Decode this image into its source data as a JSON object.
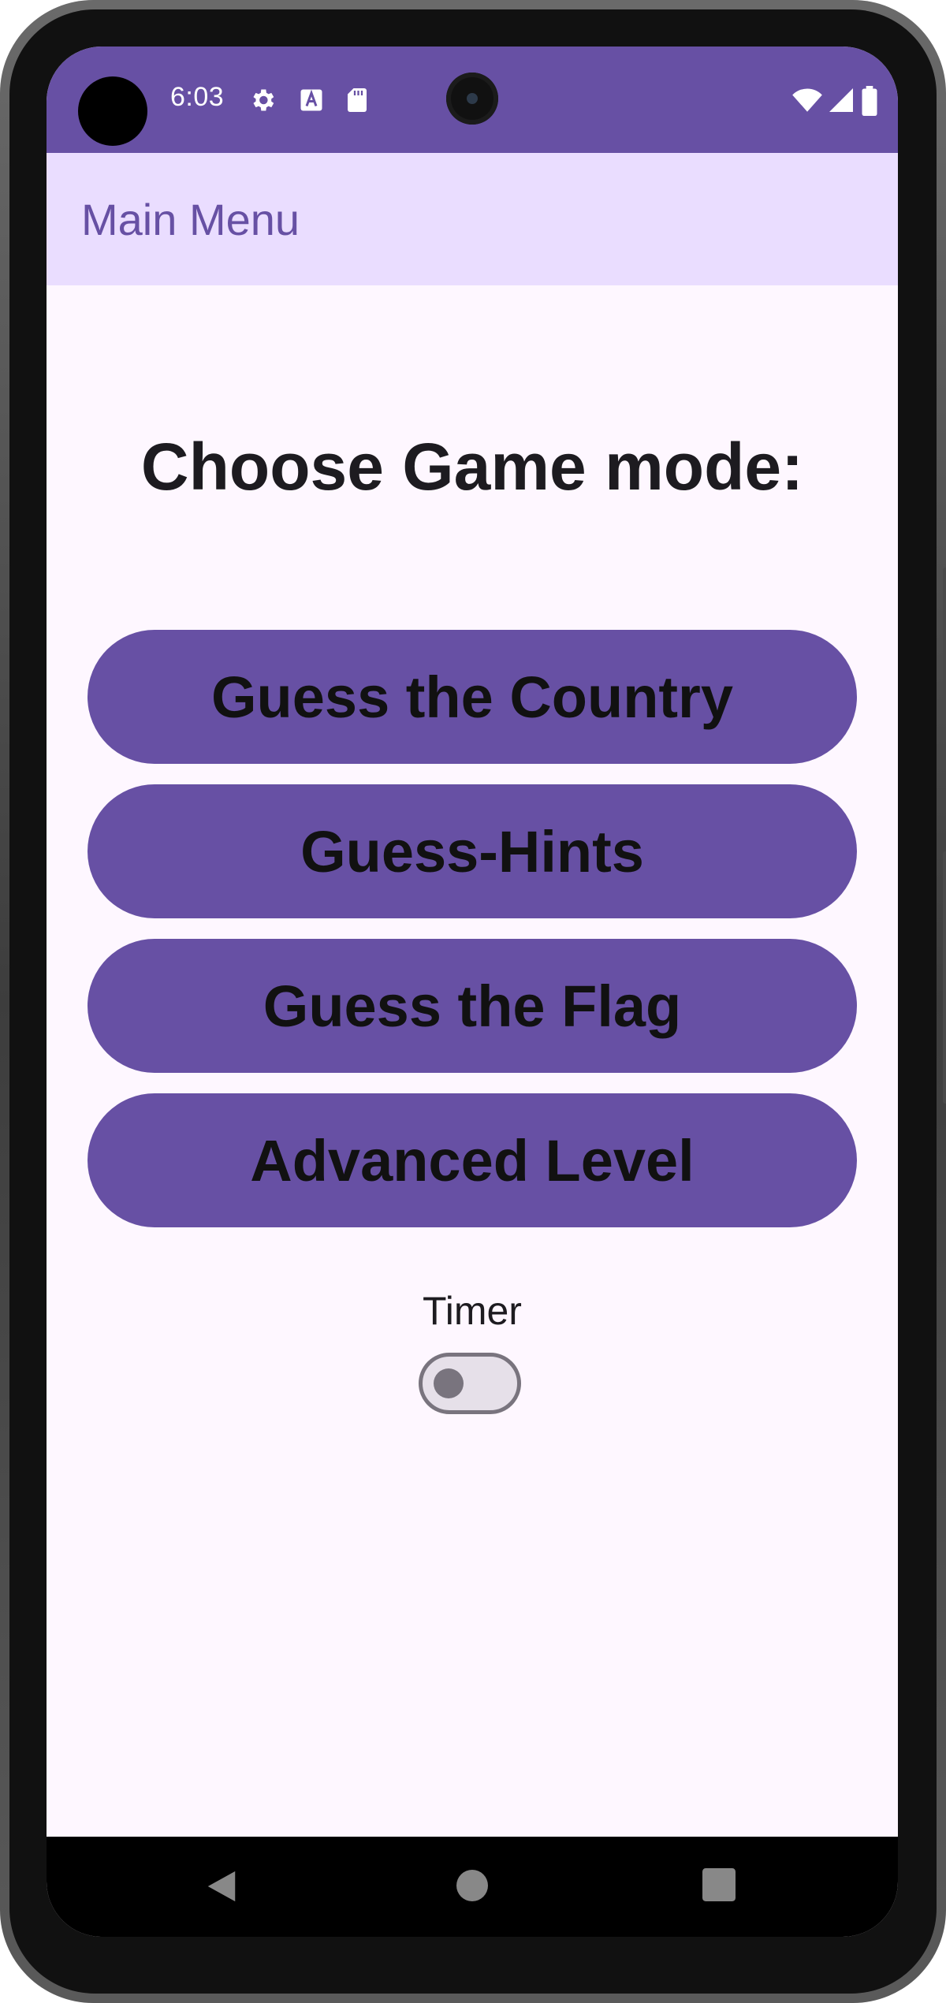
{
  "status_bar": {
    "time": "6:03",
    "icons_left": [
      "settings-gear-icon",
      "a-text-icon",
      "sd-card-icon"
    ],
    "icons_right": [
      "wifi-icon",
      "cell-signal-icon",
      "battery-icon"
    ],
    "background_color": "#6750a4"
  },
  "app_bar": {
    "title": "Main Menu",
    "background_color": "#eaddff",
    "title_color": "#6750a4"
  },
  "main": {
    "heading": "Choose Game mode:",
    "buttons": [
      {
        "label": "Guess the Country"
      },
      {
        "label": "Guess-Hints"
      },
      {
        "label": "Guess the Flag"
      },
      {
        "label": "Advanced Level"
      }
    ],
    "button_color": "#6750a4",
    "timer": {
      "label": "Timer",
      "enabled": false
    }
  },
  "nav_bar": {
    "icons": [
      "back-icon",
      "home-icon",
      "recents-icon"
    ]
  }
}
